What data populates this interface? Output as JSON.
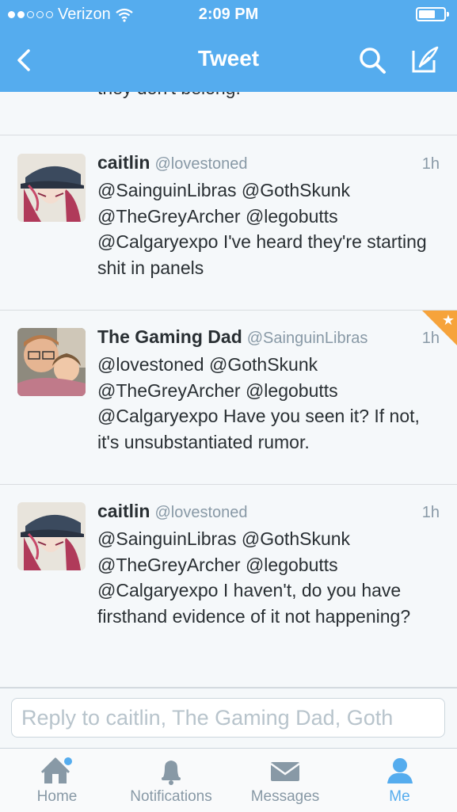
{
  "status_bar": {
    "carrier": "Verizon",
    "time": "2:09 PM"
  },
  "nav": {
    "title": "Tweet"
  },
  "previous_tweet": {
    "text": "they don't belong."
  },
  "tweets": [
    {
      "name": "caitlin",
      "handle": "@lovestoned",
      "time": "1h",
      "text": "@SainguinLibras @GothSkunk @TheGreyArcher @legobutts @Calgaryexpo I've heard they're starting shit in panels"
    },
    {
      "name": "The Gaming Dad",
      "handle": "@SainguinLibras",
      "time": "1h",
      "text": "@lovestoned @GothSkunk @TheGreyArcher @legobutts @Calgaryexpo Have you seen it? If not, it's unsubstantiated rumor."
    },
    {
      "name": "caitlin",
      "handle": "@lovestoned",
      "time": "1h",
      "text": "@SainguinLibras @GothSkunk @TheGreyArcher @legobutts @Calgaryexpo I haven't, do you have firsthand evidence of it not happening?"
    }
  ],
  "reply": {
    "placeholder": "Reply to caitlin, The Gaming Dad, Goth"
  },
  "tabs": [
    {
      "label": "Home",
      "icon": "home-icon"
    },
    {
      "label": "Notifications",
      "icon": "bell-icon"
    },
    {
      "label": "Messages",
      "icon": "envelope-icon"
    },
    {
      "label": "Me",
      "icon": "person-icon"
    }
  ],
  "colors": {
    "brand": "#55acee",
    "favorite": "#f6a33b"
  }
}
